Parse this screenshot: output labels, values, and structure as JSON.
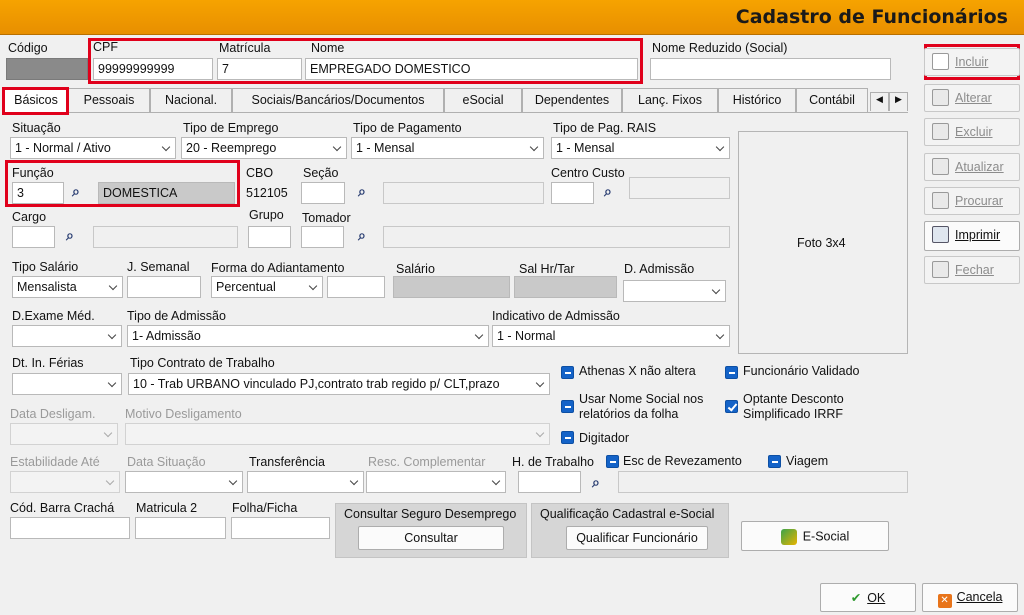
{
  "title": "Cadastro de Funcionários",
  "header": {
    "codigo_label": "Código",
    "cpf_label": "CPF",
    "cpf_value": "99999999999",
    "matricula_label": "Matrícula",
    "matricula_value": "7",
    "nome_label": "Nome",
    "nome_value": "EMPREGADO DOMESTICO",
    "nome_reduzido_label": "Nome Reduzido (Social)",
    "nome_reduzido_value": ""
  },
  "tabs": [
    "Básicos",
    "Pessoais",
    "Nacional.",
    "Sociais/Bancários/Documentos",
    "eSocial",
    "Dependentes",
    "Lanç. Fixos",
    "Histórico",
    "Contábil"
  ],
  "form": {
    "situacao_label": "Situação",
    "situacao_value": "1 - Normal / Ativo",
    "tipo_emprego_label": "Tipo de Emprego",
    "tipo_emprego_value": "20 - Reemprego",
    "tipo_pagamento_label": "Tipo de Pagamento",
    "tipo_pagamento_value": "1 - Mensal",
    "tipo_pag_rais_label": "Tipo de Pag. RAIS",
    "tipo_pag_rais_value": "1 - Mensal",
    "funcao_label": "Função",
    "funcao_code": "3",
    "funcao_desc": "DOMESTICA",
    "cbo_label": "CBO",
    "cbo_value": "512105",
    "secao_label": "Seção",
    "centro_custo_label": "Centro Custo",
    "cargo_label": "Cargo",
    "grupo_label": "Grupo",
    "tomador_label": "Tomador",
    "tipo_salario_label": "Tipo Salário",
    "tipo_salario_value": "Mensalista",
    "j_semanal_label": "J. Semanal",
    "forma_adiant_label": "Forma do Adiantamento",
    "forma_adiant_value": "Percentual",
    "salario_label": "Salário",
    "sal_hr_label": "Sal Hr/Tar",
    "d_admissao_label": "D. Admissão",
    "d_exame_label": "D.Exame Méd.",
    "tipo_admissao_label": "Tipo de Admissão",
    "tipo_admissao_value": "1- Admissão",
    "indicativo_admissao_label": "Indicativo de Admissão",
    "indicativo_admissao_value": "1 - Normal",
    "dt_ferias_label": "Dt. In. Férias",
    "tipo_contrato_label": "Tipo Contrato de Trabalho",
    "tipo_contrato_value": "10 - Trab URBANO vinculado PJ,contrato trab regido p/ CLT,prazo",
    "data_deslig_label": "Data Desligam.",
    "motivo_deslig_label": "Motivo Desligamento",
    "estabilidade_label": "Estabilidade Até",
    "data_situacao_label": "Data Situação",
    "transferencia_label": "Transferência",
    "resc_compl_label": "Resc. Complementar",
    "h_trabalho_label": "H. de Trabalho",
    "cod_barra_label": "Cód. Barra Crachá",
    "matricula2_label": "Matricula 2",
    "folha_ficha_label": "Folha/Ficha",
    "foto_label": "Foto 3x4"
  },
  "checks": {
    "athenas": "Athenas X não altera",
    "func_validado": "Funcionário Validado",
    "nome_social_1": "Usar Nome Social nos",
    "nome_social_2": "relatórios da folha",
    "optante_1": "Optante Desconto",
    "optante_2": "Simplificado IRRF",
    "digitador": "Digitador",
    "esc_revezamento": "Esc de Revezamento",
    "viagem": "Viagem"
  },
  "groups": {
    "seguro_title": "Consultar Seguro Desemprego",
    "seguro_button": "Consultar",
    "qualif_title": "Qualificação Cadastral e-Social",
    "qualif_button": "Qualificar Funcionário",
    "esocial_button": "E-Social"
  },
  "side": {
    "incluir": "Incluir",
    "alterar": "Alterar",
    "excluir": "Excluir",
    "atualizar": "Atualizar",
    "procurar": "Procurar",
    "imprimir": "Imprimir",
    "fechar": "Fechar"
  },
  "footer": {
    "ok": "OK",
    "cancela": "Cancela"
  },
  "colors": {
    "title_bar": "#f29b00",
    "highlight": "#e0001b",
    "checkbox": "#1463c8"
  }
}
